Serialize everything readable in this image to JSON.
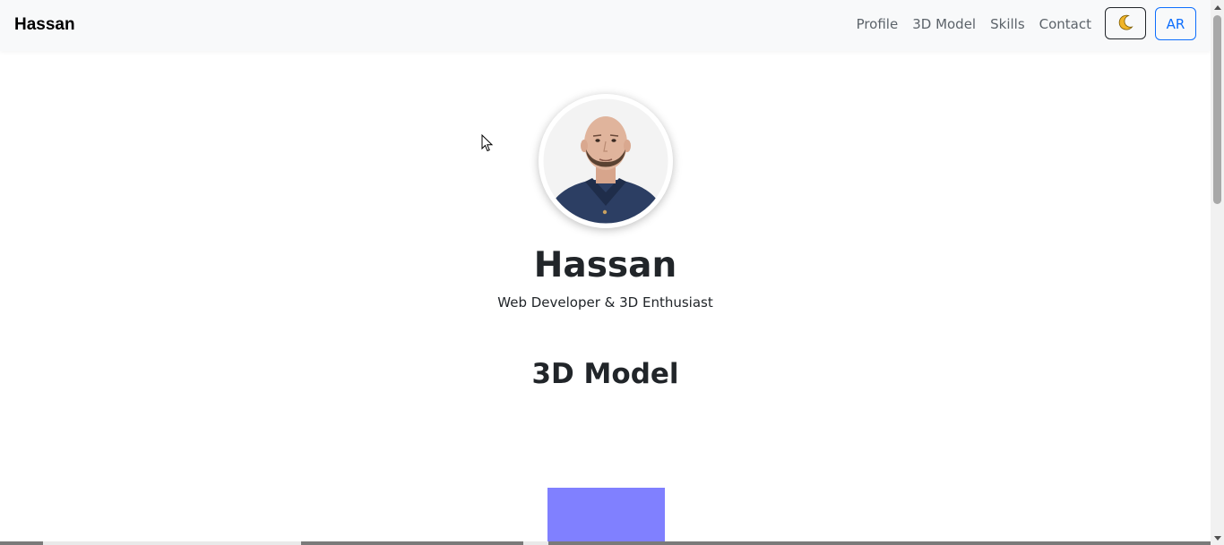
{
  "navbar": {
    "brand": "Hassan",
    "links": [
      "Profile",
      "3D Model",
      "Skills",
      "Contact"
    ],
    "theme_icon": "moon-icon",
    "lang_label": "AR"
  },
  "profile": {
    "name": "Hassan",
    "tagline": "Web Developer & 3D Enthusiast",
    "avatar": "avatar-photo"
  },
  "model_section": {
    "title": "3D Model",
    "cube_color": "#8080ff"
  },
  "colors": {
    "navbar_bg": "#f8f9fa",
    "accent": "#0d6efd",
    "moon": "#f0b429"
  }
}
